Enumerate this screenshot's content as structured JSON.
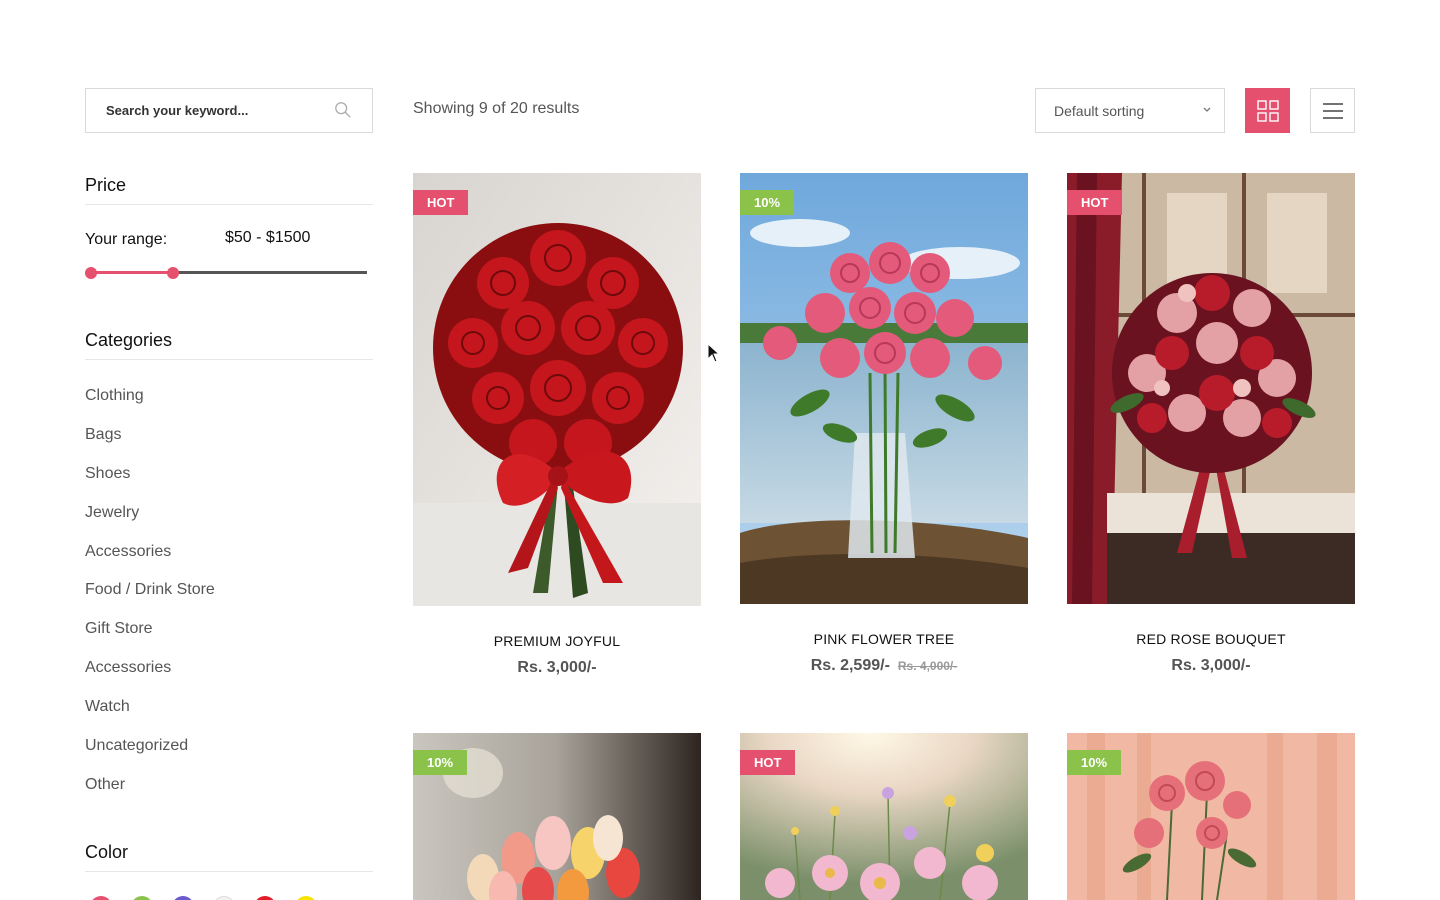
{
  "search": {
    "placeholder": "Search your keyword..."
  },
  "price_widget": {
    "title": "Price",
    "range_label": "Your range:",
    "range_value": "$50 - $1500",
    "slider": {
      "min_fraction": 0.0,
      "max_fraction": 0.3
    }
  },
  "categories": {
    "title": "Categories",
    "items": [
      "Clothing",
      "Bags",
      "Shoes",
      "Jewelry",
      "Accessories",
      "Food / Drink Store",
      "Gift Store",
      "Accessories",
      "Watch",
      "Uncategorized",
      "Other"
    ]
  },
  "color_widget": {
    "title": "Color",
    "swatches": [
      "#e8506f",
      "#8bc34a",
      "#6a5acd",
      "#f2f2f2",
      "#e31d2a",
      "#f5e400"
    ]
  },
  "toolbar": {
    "results_text": "Showing 9 of 20 results",
    "sort_label": "Default sorting",
    "grid_view_icon": "grid-icon",
    "list_view_icon": "list-icon"
  },
  "accent_color": "#e6506f",
  "sale_color": "#8bc34a",
  "products": [
    {
      "badge": "HOT",
      "name": "PREMIUM JOYFUL",
      "price": "Rs. 3,000/-",
      "old_price": ""
    },
    {
      "badge": "10%",
      "name": "PINK FLOWER TREE",
      "price": "Rs. 2,599/-",
      "old_price": "Rs. 4,000/-"
    },
    {
      "badge": "HOT",
      "name": "RED ROSE BOUQUET",
      "price": "Rs. 3,000/-",
      "old_price": ""
    },
    {
      "badge": "10%",
      "name": "",
      "price": "",
      "old_price": ""
    },
    {
      "badge": "HOT",
      "name": "",
      "price": "",
      "old_price": ""
    },
    {
      "badge": "10%",
      "name": "",
      "price": "",
      "old_price": ""
    }
  ]
}
